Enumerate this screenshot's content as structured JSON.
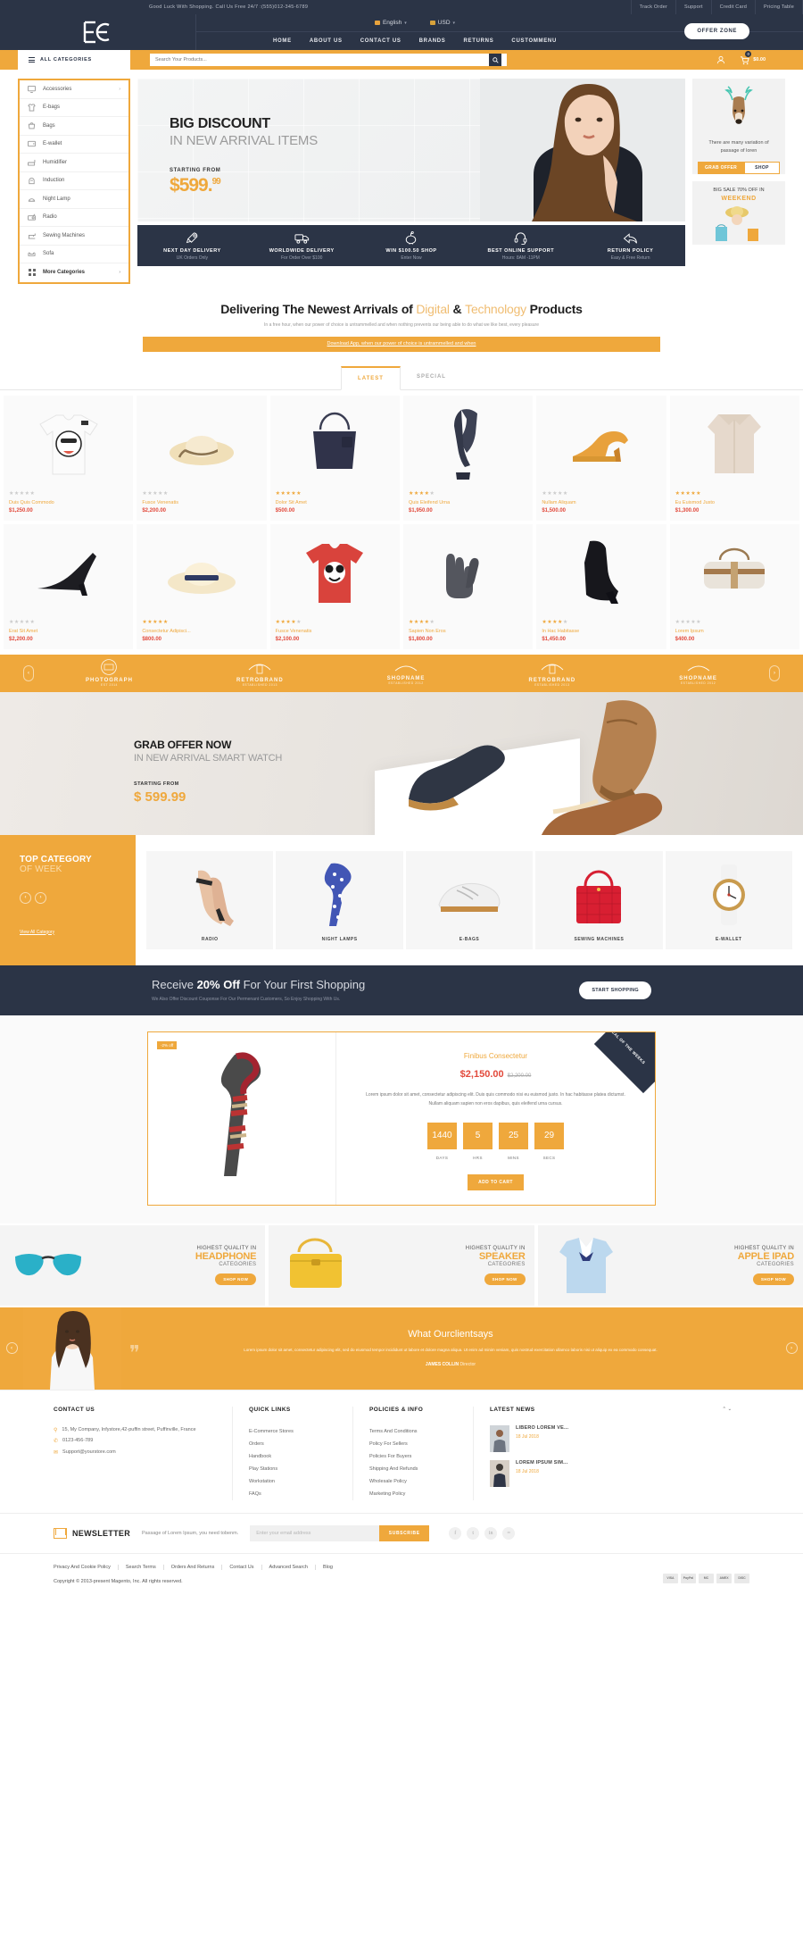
{
  "topbar": {
    "message": "Good Luck With Shopping. Call Us Free 24/7 :(555)012-345-6789",
    "links": [
      "Track Order",
      "Support",
      "Credit Card",
      "Pricing Table"
    ]
  },
  "header": {
    "language": "English",
    "currency": "USD",
    "nav": [
      "HOME",
      "ABOUT US",
      "CONTACT US",
      "BRANDS",
      "RETURNS",
      "CUSTOMMENU"
    ],
    "offer_zone": "OFFER ZONE"
  },
  "searchbar": {
    "all_categories": "ALL CATEGORIES",
    "placeholder": "Search Your Products...",
    "cart_count": "0",
    "cart_total": "$0.00"
  },
  "sidebar_categories": [
    {
      "label": "Accessories",
      "icon": "monitor-icon",
      "has_arrow": true
    },
    {
      "label": "E-bags",
      "icon": "shirt-icon",
      "has_arrow": false
    },
    {
      "label": "Bags",
      "icon": "bag-icon",
      "has_arrow": false
    },
    {
      "label": "E-wallet",
      "icon": "wallet-icon",
      "has_arrow": false
    },
    {
      "label": "Humidifier",
      "icon": "humidifier-icon",
      "has_arrow": false
    },
    {
      "label": "Induction",
      "icon": "induction-icon",
      "has_arrow": false
    },
    {
      "label": "Night Lamp",
      "icon": "lamp-icon",
      "has_arrow": false
    },
    {
      "label": "Radio",
      "icon": "radio-icon",
      "has_arrow": false
    },
    {
      "label": "Sewing Machines",
      "icon": "sewing-icon",
      "has_arrow": false
    },
    {
      "label": "Sofa",
      "icon": "sofa-icon",
      "has_arrow": false
    },
    {
      "label": "More Categories",
      "icon": "grid-icon",
      "has_arrow": true
    }
  ],
  "hero": {
    "title": "BIG DISCOUNT",
    "subtitle": "IN NEW ARRIVAL ITEMS",
    "starting_from": "STARTING FROM",
    "currency_symbol": "$",
    "price": "599.",
    "cents": "99"
  },
  "services": [
    {
      "icon": "rocket-icon",
      "title": "NEXT DAY DELIVERY",
      "sub": "UK Orders Only"
    },
    {
      "icon": "truck-icon",
      "title": "WORLDWIDE DELIVERY",
      "sub": "For Order Over $100"
    },
    {
      "icon": "piggybank-icon",
      "title": "WIN $100.50 SHOP",
      "sub": "Enter Now"
    },
    {
      "icon": "headset-icon",
      "title": "BEST ONLINE SUPPORT",
      "sub": "Hours: 8AM -11PM"
    },
    {
      "icon": "return-arrow-icon",
      "title": "RETURN POLICY",
      "sub": "Easy & Free Return"
    }
  ],
  "promos": {
    "card1": {
      "text": "There are many variation of passage of loren",
      "cta_left": "GRAB OFFER",
      "cta_right": "SHOP",
      "image": "deer-head-icon"
    },
    "card2": {
      "title": "BIG SALE 70% OFF IN",
      "subtitle": "WEEKEND",
      "image": "woman-shopping-icon"
    }
  },
  "arrivals": {
    "title_a": "Delivering The Newest Arrivals of ",
    "title_light1": "Digital",
    "title_amp": " & ",
    "title_light2": "Technology",
    "title_b": " Products",
    "subtitle": "In a free hour, when our power of choice is untrammelled and when nothing prevents our being able to do what we like best, every pleasure",
    "download_link": "Download App, when our power of choice is untrammelled and when"
  },
  "tabs": [
    {
      "label": "LATEST",
      "active": true
    },
    {
      "label": "SPECIAL",
      "active": false
    }
  ],
  "products": [
    {
      "name": "Duis Quis Commodo",
      "price": "$1,250.00",
      "rating": 0,
      "image": "tshirt-icon"
    },
    {
      "name": "Fusce Venenatis",
      "price": "$2,200.00",
      "rating": 0,
      "image": "straw-hat-icon"
    },
    {
      "name": "Dolor Sit Amet",
      "price": "$500.00",
      "rating": 5,
      "image": "tote-bag-icon"
    },
    {
      "name": "Quis Eleifend Urna",
      "price": "$1,950.00",
      "rating": 4,
      "image": "scarf-icon"
    },
    {
      "name": "Nullam Aliquam",
      "price": "$1,500.00",
      "rating": 0,
      "image": "high-heel-icon"
    },
    {
      "name": "Eu Euismod Justo",
      "price": "$1,300.00",
      "rating": 5,
      "image": "cardigan-icon"
    },
    {
      "name": "Erat Sit Amet",
      "price": "$2,200.00",
      "rating": 0,
      "image": "black-pump-icon"
    },
    {
      "name": "Consectetur Adipisci...",
      "price": "$800.00",
      "rating": 5,
      "image": "panama-hat-icon"
    },
    {
      "name": "Fusce Venenatis",
      "price": "$2,100.00",
      "rating": 4,
      "image": "red-tshirt-icon"
    },
    {
      "name": "Sapien Non Eros",
      "price": "$1,800.00",
      "rating": 4,
      "image": "gloves-icon"
    },
    {
      "name": "In Hac Habitasse",
      "price": "$1,450.00",
      "rating": 4,
      "image": "ankle-boot-icon"
    },
    {
      "name": "Lorem Ipsum",
      "price": "$400.00",
      "rating": 0,
      "image": "duffel-bag-icon"
    }
  ],
  "brands": [
    {
      "name": "PHOTOGRAPH",
      "tagline": "EST 2014"
    },
    {
      "name": "RETROBRAND",
      "tagline": "ESTABLISHED 2013"
    },
    {
      "name": "SHOPNAME",
      "tagline": "ESTABLISHED 2012"
    },
    {
      "name": "RETROBRAND",
      "tagline": "ESTABLISHED 2013"
    },
    {
      "name": "SHOPNAME",
      "tagline": "ESTABLISHED 2012"
    }
  ],
  "grab_offer": {
    "title": "GRAB OFFER NOW",
    "subtitle": "IN NEW ARRIVAL SMART WATCH",
    "starting_from": "STARTING FROM",
    "price": "$ 599.99"
  },
  "top_category": {
    "title": "TOP CATEGORY",
    "subtitle": "OF WEEK",
    "view_all": "View All Category",
    "items": [
      {
        "label": "RADIO",
        "image": "nude-heels-icon"
      },
      {
        "label": "NIGHT LAMPS",
        "image": "blue-scarf-icon"
      },
      {
        "label": "E-BAGS",
        "image": "white-sneakers-icon"
      },
      {
        "label": "SEWING MACHINES",
        "image": "red-handbag-icon"
      },
      {
        "label": "E-WALLET",
        "image": "wristwatch-icon"
      }
    ]
  },
  "receive": {
    "pre": "Receive ",
    "bold": "20% Off",
    "post": " For Your First Shopping",
    "sub": "We Also Offer Discount Couponse For Our Permenant Customers, So Enjoy Shopping With Us.",
    "button": "START SHOPPING"
  },
  "deal": {
    "badge": "-2% off",
    "ribbon": "DEAL OF THE WEEKS",
    "name": "Finibus Consectetur",
    "price": "$2,150.00",
    "old_price": "$2,200.00",
    "description": "Lorem ipsum dolor sit amet, consectetur adipiscing elit. Duis quis commodo nisi eu euismod justo. In hac habitasse platea dictumst. Nullam aliquam sapien non eros dapibus, quis eleifend urna cursus.",
    "counters": [
      {
        "value": "1440",
        "label": "DAYS"
      },
      {
        "value": "5",
        "label": "HRS"
      },
      {
        "value": "25",
        "label": "MINS"
      },
      {
        "value": "29",
        "label": "SECS"
      }
    ],
    "button": "ADD TO CART",
    "image": "plaid-scarf-icon"
  },
  "quality_banners": [
    {
      "line1": "HIGHEST QUALITY IN",
      "line2": "HEADPHONE",
      "line3": "CATEGORIES",
      "button": "SHOP NOW",
      "image": "sunglasses-icon"
    },
    {
      "line1": "HIGHEST QUALITY IN",
      "line2": "SPEAKER",
      "line3": "CATEGORIES",
      "button": "SHOP NOW",
      "image": "yellow-bag-icon"
    },
    {
      "line1": "HIGHEST QUALITY IN",
      "line2": "APPLE IPAD",
      "line3": "CATEGORIES",
      "button": "SHOP NOW",
      "image": "blue-shirt-icon"
    }
  ],
  "testimonial": {
    "title_a": "What Our",
    "title_b": "client",
    "title_c": "says",
    "quote": "Lorem ipsum dolor sit amet, consectetur adipiscing elit, sed do eiusmod tempor incididunt ut labore et dolore magna aliqua. Ut enim ad minim veniam, quis nostrud exercitation ullamco laboris nisi ut aliquip ex ea commodo consequat.",
    "name": "JAMES COLLIN",
    "role": "Director",
    "image": "woman-portrait-icon"
  },
  "footer": {
    "contact": {
      "heading": "CONTACT US",
      "address": "15, My Company, Infystore,42-puffin street, Puffinville, France",
      "phone": "0123-456-789",
      "email": "Support@yourstore.com"
    },
    "quick_links": {
      "heading": "QUICK LINKS",
      "items": [
        "E-Commerce Stores",
        "Orders",
        "Handbook",
        "Play Stations",
        "Workstation",
        "FAQs"
      ]
    },
    "policies": {
      "heading": "POLICIES & INFO",
      "items": [
        "Terms And Conditions",
        "Policy For Sellers",
        "Policies For Buyers",
        "Shipping And Refunds",
        "Wholesale Policy",
        "Marketing Policy"
      ]
    },
    "latest_news": {
      "heading": "LATEST NEWS",
      "items": [
        {
          "title": "LIBERO LOREM VE...",
          "date": "18 Jul 2018"
        },
        {
          "title": "LOREM IPSUM SIM...",
          "date": "18 Jul 2018"
        }
      ]
    },
    "newsletter": {
      "title": "NEWSLETTER",
      "sub": "Passage of Lorem Ipsum, you need tobenm.",
      "placeholder": "Enter your email address",
      "button": "SUBSCRIBE",
      "socials": [
        "facebook-icon",
        "twitter-icon",
        "linkedin-icon",
        "rss-icon"
      ]
    },
    "bottom_links": [
      "Privacy And Cookie Policy",
      "Search Terms",
      "Orders And Returns",
      "Contact Us",
      "Advanced Search",
      "Blog"
    ],
    "copyright": "Copyright © 2013-present Magento, Inc. All rights reserved.",
    "payment_cards": [
      "VISA",
      "PayPal",
      "MC",
      "AMEX",
      "DISC"
    ]
  },
  "colors": {
    "accent": "#efa83c",
    "dark": "#2b3446",
    "price_red": "#e24a3c"
  }
}
